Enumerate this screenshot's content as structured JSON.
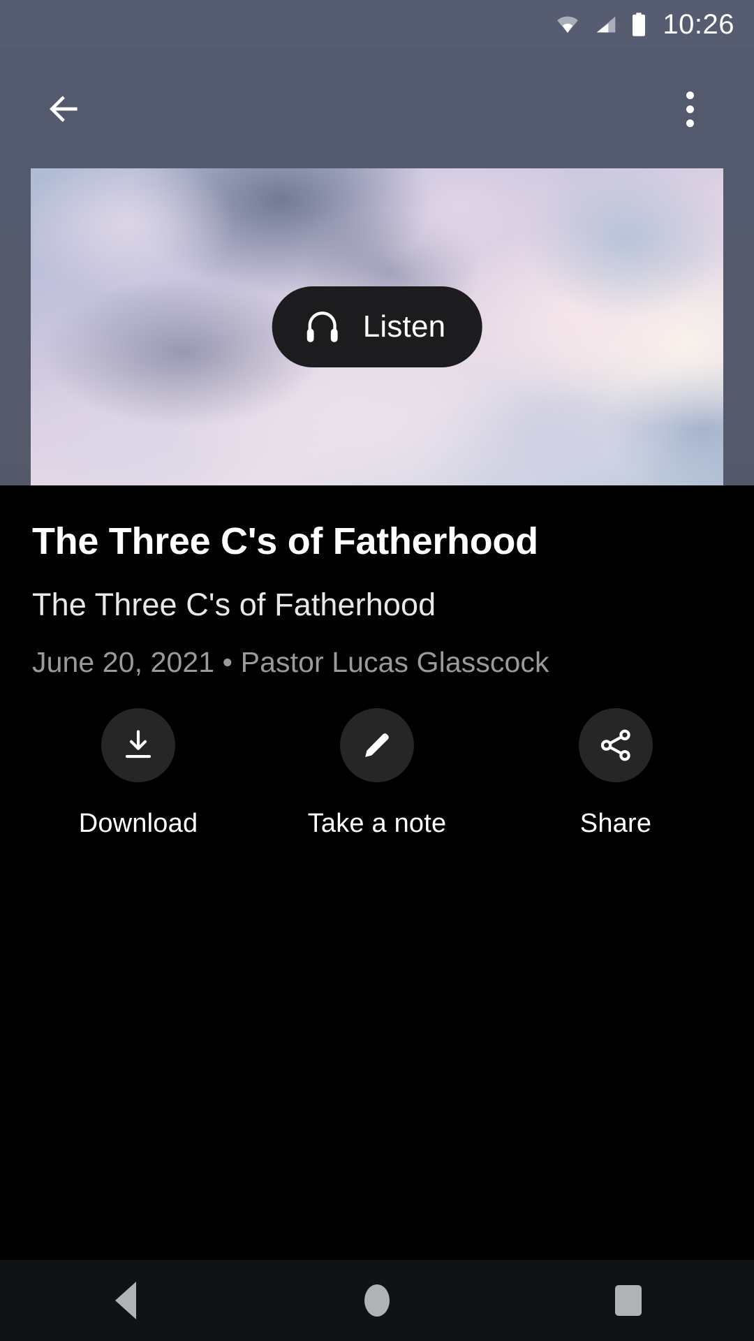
{
  "status_bar": {
    "time": "10:26",
    "icons": [
      "wifi-icon",
      "cellular-signal-icon",
      "battery-icon"
    ]
  },
  "app_bar": {
    "back_icon": "arrow-back-icon",
    "overflow_icon": "more-vertical-icon"
  },
  "hero": {
    "image_description": "pastel cloudy sky",
    "listen_button": {
      "label": "Listen",
      "icon": "headphones-icon"
    }
  },
  "sermon": {
    "title": "The Three C's of Fatherhood",
    "subtitle": "The Three C's of Fatherhood",
    "meta": "June 20, 2021 • Pastor Lucas Glasscock"
  },
  "actions": [
    {
      "label": "Download",
      "icon": "download-icon"
    },
    {
      "label": "Take a note",
      "icon": "pencil-icon"
    },
    {
      "label": "Share",
      "icon": "share-icon"
    }
  ],
  "nav_bar": {
    "back": "nav-back-icon",
    "home": "nav-home-icon",
    "recents": "nav-recents-icon"
  },
  "colors": {
    "app_bar": "#545a6d",
    "status_bar": "#565d70",
    "page_background": "#000000",
    "listen_button": "#1c1c1e",
    "action_circle": "#262626",
    "meta_text": "#9a9a9a",
    "nav_bar": "#111215"
  }
}
